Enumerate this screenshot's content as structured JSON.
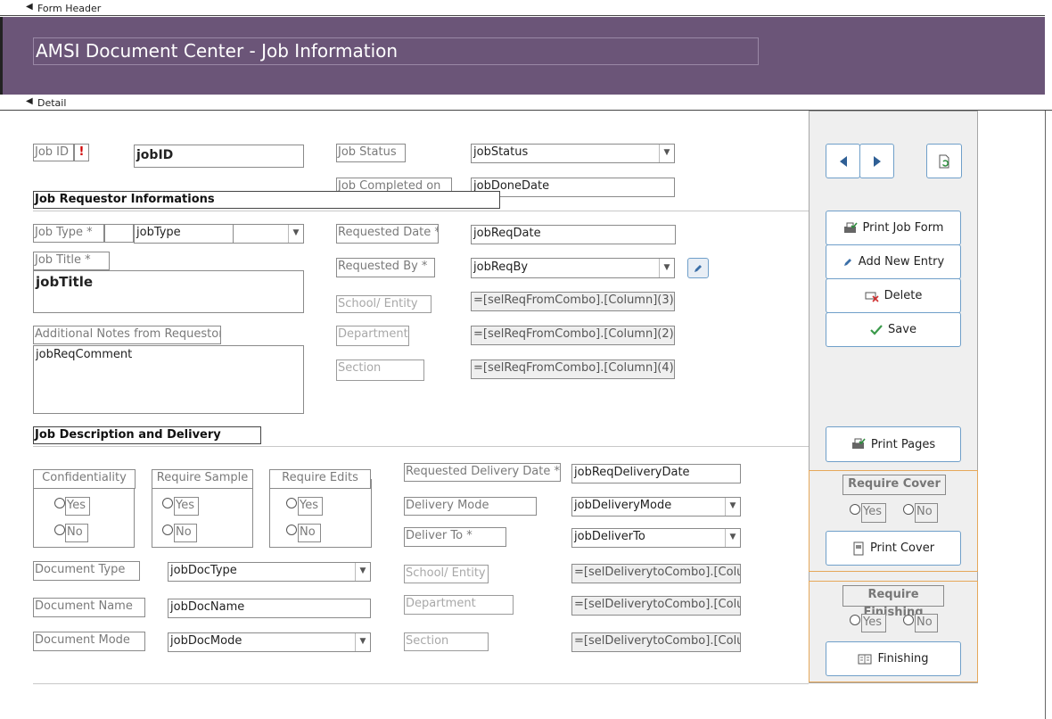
{
  "sections": {
    "header": "Form Header",
    "detail": "Detail"
  },
  "title": "AMSI Document Center - Job Information",
  "fields": {
    "job_id_label": "Job ID",
    "job_id_required_mark": "!",
    "job_id": "jobID",
    "job_status_label": "Job Status",
    "job_status": "jobStatus",
    "job_completed_label": "Job Completed on",
    "job_done_date": "jobDoneDate",
    "requestor_heading": "Job Requestor Informations",
    "job_type_label": "Job Type *",
    "job_type": "jobType",
    "requested_date_label": "Requested Date *",
    "job_req_date": "jobReqDate",
    "job_title_label": "Job Title *",
    "job_title": "jobTitle",
    "requested_by_label": "Requested By *",
    "job_req_by": "jobReqBy",
    "school_entity_label": "School/ Entity",
    "school_entity_value": "=[selReqFromCombo].[Column](3)",
    "additional_notes_label": "Additional Notes from Requestor",
    "job_req_comment": "jobReqComment",
    "department_label": "Department",
    "department_value": "=[selReqFromCombo].[Column](2)",
    "section_label": "Section",
    "section_value": "=[selReqFromCombo].[Column](4)",
    "description_heading": "Job Description and Delivery",
    "confidentiality_label": "Confidentiality",
    "require_sample_label": "Require Sample",
    "require_edits_label": "Require Edits",
    "yes": "Yes",
    "no": "No",
    "requested_delivery_label": "Requested Delivery Date *",
    "job_req_delivery_date": "jobReqDeliveryDate",
    "delivery_mode_label": "Delivery Mode",
    "job_delivery_mode": "jobDeliveryMode",
    "deliver_to_label": "Deliver To *",
    "job_deliver_to": "jobDeliverTo",
    "document_type_label": "Document Type",
    "job_doc_type": "jobDocType",
    "document_name_label": "Document Name",
    "job_doc_name": "jobDocName",
    "document_mode_label": "Document Mode",
    "job_doc_mode": "jobDocMode",
    "del_school_entity_label": "School/ Entity",
    "del_school_entity_value": "=[selDeliverytoCombo].[Colun",
    "del_department_label": "Department",
    "del_department_value": "=[selDeliverytoCombo].[Colun",
    "del_section_label": "Section",
    "del_section_value": "=[selDeliverytoCombo].[Colun"
  },
  "sidebar": {
    "print_job_form": "Print Job Form",
    "add_new_entry": "Add New Entry",
    "delete": "Delete",
    "save": "Save",
    "print_pages": "Print Pages",
    "require_cover": "Require Cover",
    "print_cover": "Print Cover",
    "require_finishing": "Require Finishing",
    "finishing": "Finishing"
  },
  "colors": {
    "header_bg": "#6b5578",
    "button_border": "#6f9fc9",
    "orange_frame": "#e6a85a",
    "required_mark": "#d00000"
  }
}
